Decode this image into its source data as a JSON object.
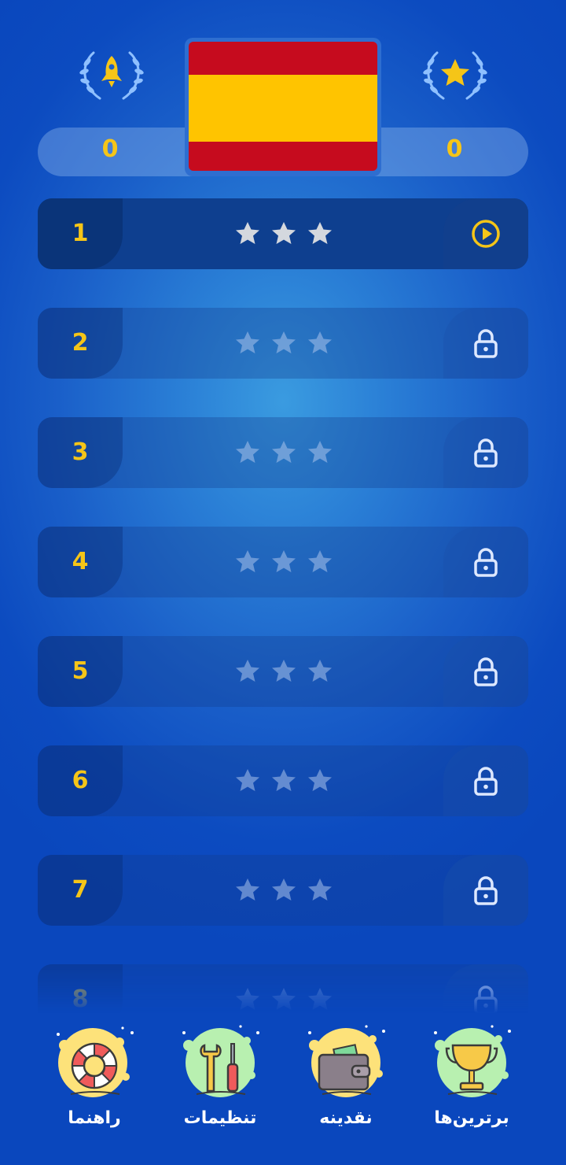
{
  "header": {
    "left_badge_icon": "rocket-icon",
    "right_badge_icon": "star-icon",
    "left_score": "0",
    "right_score": "0",
    "flag": "spain-flag",
    "colors": {
      "accent": "#f5c518",
      "flag_red": "#c60b1e",
      "flag_yellow": "#ffc400"
    }
  },
  "levels": [
    {
      "number": "1",
      "state": "active",
      "stars_earned": 0,
      "stars_total": 3,
      "icon": "play-icon"
    },
    {
      "number": "2",
      "state": "locked",
      "stars_earned": 0,
      "stars_total": 3,
      "icon": "lock-icon"
    },
    {
      "number": "3",
      "state": "locked",
      "stars_earned": 0,
      "stars_total": 3,
      "icon": "lock-icon"
    },
    {
      "number": "4",
      "state": "locked",
      "stars_earned": 0,
      "stars_total": 3,
      "icon": "lock-icon"
    },
    {
      "number": "5",
      "state": "locked",
      "stars_earned": 0,
      "stars_total": 3,
      "icon": "lock-icon"
    },
    {
      "number": "6",
      "state": "locked",
      "stars_earned": 0,
      "stars_total": 3,
      "icon": "lock-icon"
    },
    {
      "number": "7",
      "state": "locked",
      "stars_earned": 0,
      "stars_total": 3,
      "icon": "lock-icon"
    },
    {
      "number": "8",
      "state": "locked",
      "stars_earned": 0,
      "stars_total": 3,
      "icon": "lock-icon"
    }
  ],
  "bottom_nav": [
    {
      "label": "راهنما",
      "icon": "lifebuoy-icon"
    },
    {
      "label": "تنظیمات",
      "icon": "tools-icon"
    },
    {
      "label": "نقدینه",
      "icon": "wallet-icon"
    },
    {
      "label": "برترین‌ها",
      "icon": "trophy-icon"
    }
  ]
}
